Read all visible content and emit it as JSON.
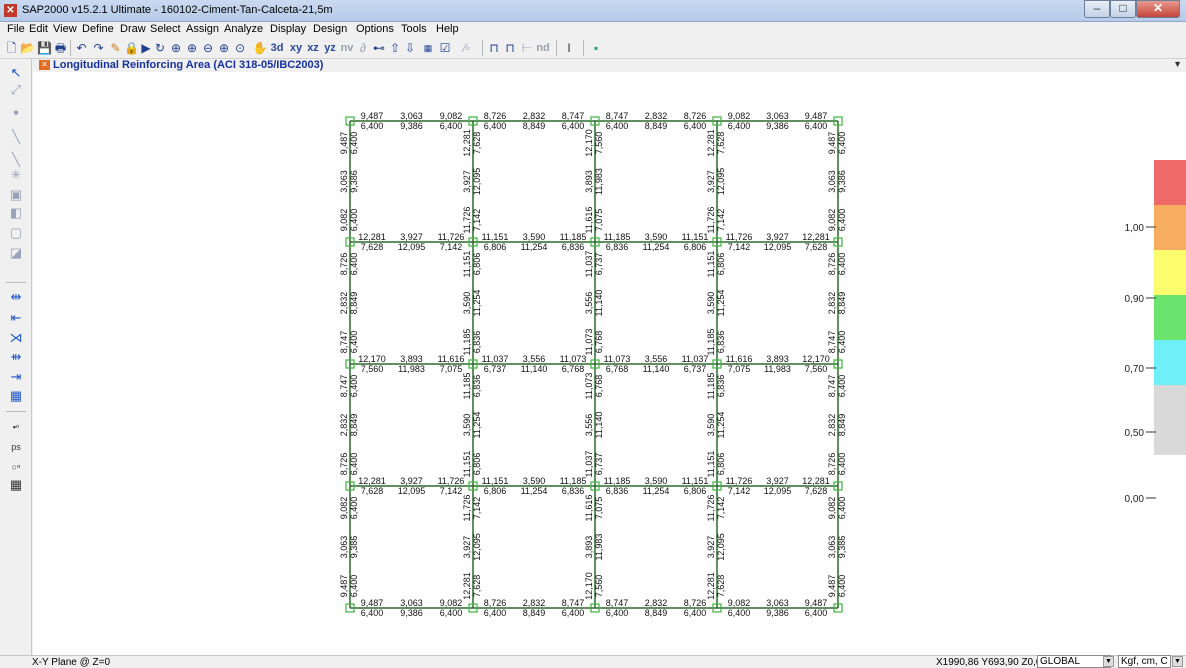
{
  "window": {
    "title": "SAP2000 v15.2.1 Ultimate  - 160102-Ciment-Tan-Calceta-21,5m"
  },
  "menu": [
    "File",
    "Edit",
    "View",
    "Define",
    "Draw",
    "Select",
    "Assign",
    "Analyze",
    "Display",
    "Design",
    "Options",
    "Tools",
    "Help"
  ],
  "toolbar": {
    "views": [
      "xy",
      "xz",
      "yz",
      "nv"
    ],
    "nd_label": "nd",
    "icons": [
      "new-icon",
      "open-icon",
      "save-icon",
      "print-icon",
      "undo-icon",
      "redo-icon",
      "edit-icon",
      "lock-icon",
      "run-icon",
      "refresh-icon",
      "zoom-window-icon",
      "zoom-in-icon",
      "zoom-out-icon",
      "zoom-prev-icon",
      "zoom-full-icon",
      "pan-icon",
      "3d-view-icon",
      "view-xy-icon",
      "view-xz-icon",
      "view-yz-icon",
      "view-nv-icon",
      "rotate-icon",
      "perspective-icon",
      "up-icon",
      "down-icon",
      "object-shrink-icon",
      "display-options-icon",
      "grid-icon",
      "frame-icon",
      "shell-icon",
      "axis-icon",
      "section-icon",
      "color-icon"
    ]
  },
  "left_toolbar": {
    "icons": [
      "pointer-icon",
      "reshape-icon",
      "joint-icon",
      "draw-frame-icon",
      "quick-frame-icon",
      "draw-area-icon",
      "rect-area-icon",
      "quick-area-icon",
      "solid-icon",
      "link-icon",
      "select-all-icon",
      "select-prev-icon",
      "clear-select-icon",
      "intersect-icon",
      "restore-icon",
      "snap-grid-icon",
      "snap-joint-icon",
      "snap-point-icon",
      "snap-end-icon"
    ]
  },
  "view": {
    "title": "Longitudinal Reinforcing Area  (ACI 318-05/IBC2003)"
  },
  "legend": {
    "labels": [
      "1,00",
      "0,90",
      "0,70",
      "0,50",
      "0,00"
    ],
    "colors": [
      "#f06a6a",
      "#f6ad5f",
      "#fdfd6e",
      "#6ce36c",
      "#6ff0f8",
      "#d9d9d9"
    ]
  },
  "statusbar": {
    "left": "X-Y Plane @ Z=0",
    "coords": "X1990,86  Y693,90  Z0,00",
    "coord_system": "GLOBAL",
    "units": "Kgf, cm, C"
  },
  "chart_data": {
    "type": "frame_design_values",
    "title": "Longitudinal Reinforcing Area  (ACI 318-05/IBC2003)",
    "units": "Kgf, cm, C",
    "horizontal_beams": [
      {
        "row": 1,
        "bays": [
          {
            "top": [
              "9,487",
              "3,063",
              "9,082"
            ],
            "bottom": [
              "6,400",
              "9,386",
              "6,400"
            ]
          },
          {
            "top": [
              "8,726",
              "2,832",
              "8,747"
            ],
            "bottom": [
              "6,400",
              "8,849",
              "6,400"
            ]
          },
          {
            "top": [
              "8,747",
              "2,832",
              "8,726"
            ],
            "bottom": [
              "6,400",
              "8,849",
              "6,400"
            ]
          },
          {
            "top": [
              "9,082",
              "3,063",
              "9,487"
            ],
            "bottom": [
              "6,400",
              "9,386",
              "6,400"
            ]
          }
        ]
      },
      {
        "row": 2,
        "bays": [
          {
            "top": [
              "12,281",
              "3,927",
              "11,726"
            ],
            "bottom": [
              "7,628",
              "12,095",
              "7,142"
            ]
          },
          {
            "top": [
              "11,151",
              "3,590",
              "11,185"
            ],
            "bottom": [
              "6,806",
              "11,254",
              "6,836"
            ]
          },
          {
            "top": [
              "11,185",
              "3,590",
              "11,151"
            ],
            "bottom": [
              "6,836",
              "11,254",
              "6,806"
            ]
          },
          {
            "top": [
              "11,726",
              "3,927",
              "12,281"
            ],
            "bottom": [
              "7,142",
              "12,095",
              "7,628"
            ]
          }
        ]
      },
      {
        "row": 3,
        "bays": [
          {
            "top": [
              "12,170",
              "3,893",
              "11,616"
            ],
            "bottom": [
              "7,560",
              "11,983",
              "7,075"
            ]
          },
          {
            "top": [
              "11,037",
              "3,556",
              "11,073"
            ],
            "bottom": [
              "6,737",
              "11,140",
              "6,768"
            ]
          },
          {
            "top": [
              "11,073",
              "3,556",
              "11,037"
            ],
            "bottom": [
              "6,768",
              "11,140",
              "6,737"
            ]
          },
          {
            "top": [
              "11,616",
              "3,893",
              "12,170"
            ],
            "bottom": [
              "7,075",
              "11,983",
              "7,560"
            ]
          }
        ]
      },
      {
        "row": 4,
        "bays": [
          {
            "top": [
              "12,281",
              "3,927",
              "11,726"
            ],
            "bottom": [
              "7,628",
              "12,095",
              "7,142"
            ]
          },
          {
            "top": [
              "11,151",
              "3,590",
              "11,185"
            ],
            "bottom": [
              "6,806",
              "11,254",
              "6,836"
            ]
          },
          {
            "top": [
              "11,185",
              "3,590",
              "11,151"
            ],
            "bottom": [
              "6,836",
              "11,254",
              "6,806"
            ]
          },
          {
            "top": [
              "11,726",
              "3,927",
              "12,281"
            ],
            "bottom": [
              "7,142",
              "12,095",
              "7,628"
            ]
          }
        ]
      },
      {
        "row": 5,
        "bays": [
          {
            "top": [
              "9,487",
              "3,063",
              "9,082"
            ],
            "bottom": [
              "6,400",
              "9,386",
              "6,400"
            ]
          },
          {
            "top": [
              "8,726",
              "2,832",
              "8,747"
            ],
            "bottom": [
              "6,400",
              "8,849",
              "6,400"
            ]
          },
          {
            "top": [
              "8,747",
              "2,832",
              "8,726"
            ],
            "bottom": [
              "6,400",
              "8,849",
              "6,400"
            ]
          },
          {
            "top": [
              "9,082",
              "3,063",
              "9,487"
            ],
            "bottom": [
              "6,400",
              "9,386",
              "6,400"
            ]
          }
        ]
      }
    ],
    "vertical_beams": [
      {
        "col": 1,
        "spans": [
          {
            "left": [
              "9,487",
              "3,063",
              "9,082"
            ],
            "right": [
              "6,400",
              "9,386",
              "6,400"
            ]
          },
          {
            "left": [
              "8,726",
              "2,832",
              "8,747"
            ],
            "right": [
              "6,400",
              "8,849",
              "6,400"
            ]
          },
          {
            "left": [
              "8,747",
              "2,832",
              "8,726"
            ],
            "right": [
              "6,400",
              "8,849",
              "6,400"
            ]
          },
          {
            "left": [
              "9,082",
              "3,063",
              "9,487"
            ],
            "right": [
              "6,400",
              "9,386",
              "6,400"
            ]
          }
        ]
      },
      {
        "col": 2,
        "spans": [
          {
            "left": [
              "12,281",
              "3,927",
              "11,726"
            ],
            "right": [
              "7,628",
              "12,095",
              "7,142"
            ]
          },
          {
            "left": [
              "11,151",
              "3,590",
              "11,185"
            ],
            "right": [
              "6,806",
              "11,254",
              "6,836"
            ]
          },
          {
            "left": [
              "11,185",
              "3,590",
              "11,151"
            ],
            "right": [
              "6,836",
              "11,254",
              "6,806"
            ]
          },
          {
            "left": [
              "11,726",
              "3,927",
              "12,281"
            ],
            "right": [
              "7,142",
              "12,095",
              "7,628"
            ]
          }
        ]
      },
      {
        "col": 3,
        "spans": [
          {
            "left": [
              "12,170",
              "3,893",
              "11,616"
            ],
            "right": [
              "7,560",
              "11,983",
              "7,075"
            ]
          },
          {
            "left": [
              "11,037",
              "3,556",
              "11,073"
            ],
            "right": [
              "6,737",
              "11,140",
              "6,768"
            ]
          },
          {
            "left": [
              "11,073",
              "3,556",
              "11,037"
            ],
            "right": [
              "6,768",
              "11,140",
              "6,737"
            ]
          },
          {
            "left": [
              "11,616",
              "3,893",
              "12,170"
            ],
            "right": [
              "7,075",
              "11,983",
              "7,560"
            ]
          }
        ]
      },
      {
        "col": 4,
        "spans": [
          {
            "left": [
              "12,281",
              "3,927",
              "11,726"
            ],
            "right": [
              "7,628",
              "12,095",
              "7,142"
            ]
          },
          {
            "left": [
              "11,151",
              "3,590",
              "11,185"
            ],
            "right": [
              "6,806",
              "11,254",
              "6,836"
            ]
          },
          {
            "left": [
              "11,185",
              "3,590",
              "11,151"
            ],
            "right": [
              "6,836",
              "11,254",
              "6,806"
            ]
          },
          {
            "left": [
              "11,726",
              "3,927",
              "12,281"
            ],
            "right": [
              "7,142",
              "12,095",
              "7,628"
            ]
          }
        ]
      },
      {
        "col": 5,
        "spans": [
          {
            "left": [
              "9,487",
              "3,063",
              "9,082"
            ],
            "right": [
              "6,400",
              "9,386",
              "6,400"
            ]
          },
          {
            "left": [
              "8,726",
              "2,832",
              "8,747"
            ],
            "right": [
              "6,400",
              "8,849",
              "6,400"
            ]
          },
          {
            "left": [
              "8,747",
              "2,832",
              "8,726"
            ],
            "right": [
              "6,400",
              "8,849",
              "6,400"
            ]
          },
          {
            "left": [
              "9,082",
              "3,063",
              "9,487"
            ],
            "right": [
              "6,400",
              "9,386",
              "6,400"
            ]
          }
        ]
      }
    ]
  }
}
